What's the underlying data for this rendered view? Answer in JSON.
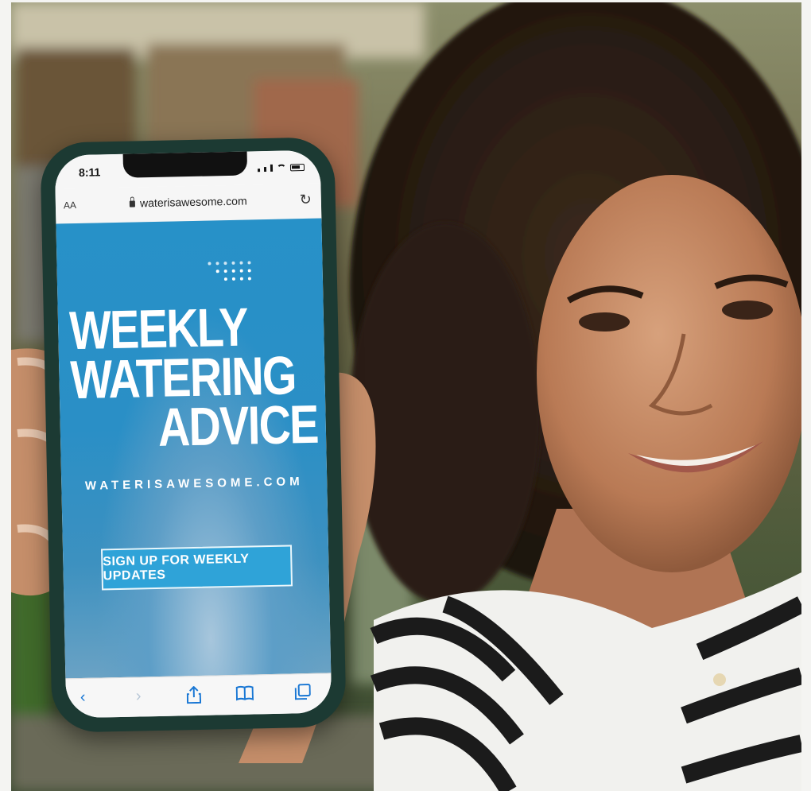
{
  "phone": {
    "status_time": "8:11",
    "text_size_label": "AA",
    "url": "waterisawesome.com",
    "icons": [
      "lock-icon",
      "reload-icon",
      "signal-icon",
      "wifi-icon",
      "battery-icon"
    ]
  },
  "webpage": {
    "headline": [
      "WEEKLY",
      "WATERING",
      "ADVICE"
    ],
    "site_name": "WATERISAWESOME.COM",
    "cta_label": "SIGN UP FOR WEEKLY UPDATES",
    "background_color": "#2a8fc6"
  },
  "toolbar": {
    "back_glyph": "‹",
    "forward_glyph": "›",
    "icons": [
      "back-icon",
      "forward-icon",
      "share-icon",
      "bookmarks-icon",
      "tabs-icon"
    ]
  }
}
